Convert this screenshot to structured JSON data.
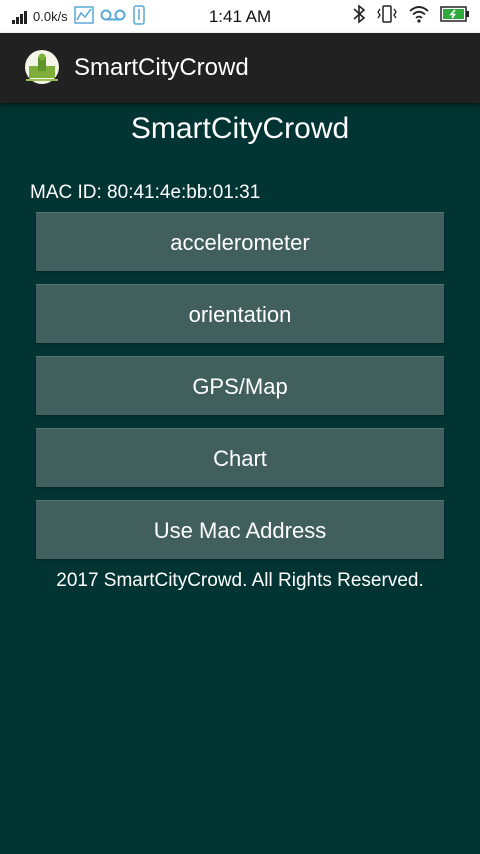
{
  "status_bar": {
    "network_speed": "0.0k/s",
    "time": "1:41 AM",
    "icons": [
      "signal-icon",
      "chart-icon",
      "voicemail-icon",
      "usb-icon",
      "bluetooth-icon",
      "vibrate-icon",
      "wifi-icon",
      "battery-icon"
    ]
  },
  "app_bar": {
    "title": "SmartCityCrowd"
  },
  "main": {
    "title": "SmartCityCrowd",
    "mac_label": "MAC ID: 80:41:4e:bb:01:31",
    "buttons": [
      "accelerometer",
      "orientation",
      "GPS/Map",
      "Chart",
      "Use Mac Address"
    ],
    "footer": "2017 SmartCityCrowd. All Rights Reserved."
  },
  "colors": {
    "background": "#013432",
    "app_bar": "#212121",
    "button": "#41605d",
    "text": "#ffffff"
  }
}
